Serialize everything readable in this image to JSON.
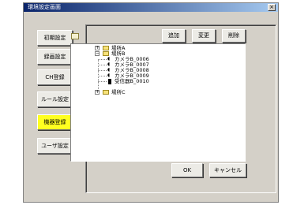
{
  "window": {
    "title": "環境設定画面",
    "close_label": "×"
  },
  "sidebar": {
    "items": [
      {
        "label": "初期設定",
        "active": false
      },
      {
        "label": "録画設定",
        "active": false
      },
      {
        "label": "CH登録",
        "active": false
      },
      {
        "label": "ルール設定",
        "active": false
      },
      {
        "label": "機器登録",
        "active": true
      },
      {
        "label": "ユーザ設定",
        "active": false
      }
    ]
  },
  "toolbar": {
    "add_label": "追加",
    "edit_label": "変更",
    "delete_label": "削除"
  },
  "tree": {
    "nodes": [
      {
        "label": "場所A",
        "type": "folder",
        "expander": "+"
      },
      {
        "label": "場所B",
        "type": "folder",
        "expander": "−"
      },
      {
        "label": "カメラB_0006",
        "type": "camera"
      },
      {
        "label": "カメラB_0007",
        "type": "camera"
      },
      {
        "label": "カメラB_0008",
        "type": "camera"
      },
      {
        "label": "カメラB_0009",
        "type": "camera"
      },
      {
        "label": "受信器B_0010",
        "type": "receiver"
      },
      {
        "label": "場所C",
        "type": "folder",
        "expander": "+"
      }
    ]
  },
  "footer": {
    "ok_label": "OK",
    "cancel_label": "キャンセル"
  },
  "colors": {
    "active_button": "#ffff20",
    "dialog_bg": "#d4d0c8",
    "title_bar": "#0a246a"
  }
}
